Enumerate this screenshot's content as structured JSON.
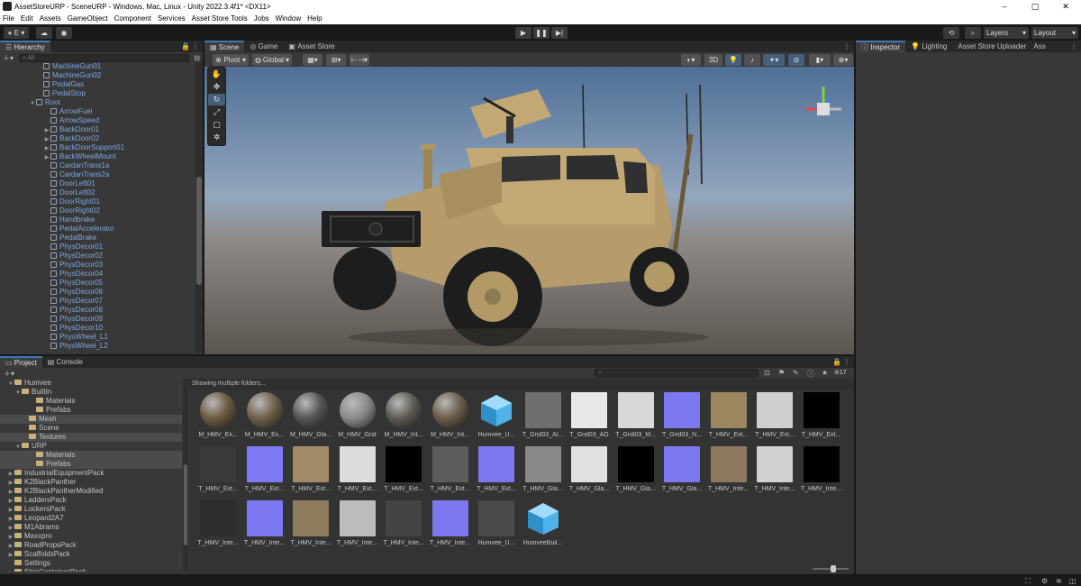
{
  "window": {
    "title": "AssetStoreURP - SceneURP - Windows, Mac, Linux - Unity 2022.3.4f1* <DX11>",
    "min": "–",
    "max": "▢",
    "close": "✕"
  },
  "menu": [
    "File",
    "Edit",
    "Assets",
    "GameObject",
    "Component",
    "Services",
    "Asset Store Tools",
    "Jobs",
    "Window",
    "Help"
  ],
  "toolbar": {
    "account": "E ▾",
    "layers": "Layers",
    "layout": "Layout"
  },
  "hierarchy": {
    "tab": "Hierarchy",
    "search_placeholder": "All",
    "items": [
      {
        "label": "MachineGun01",
        "indent": 5
      },
      {
        "label": "MachineGun02",
        "indent": 5
      },
      {
        "label": "PedalGas",
        "indent": 5
      },
      {
        "label": "PedalStop",
        "indent": 5
      },
      {
        "label": "Root",
        "indent": 4,
        "open": true
      },
      {
        "label": "ArrowFuel",
        "indent": 6
      },
      {
        "label": "ArrowSpeed",
        "indent": 6
      },
      {
        "label": "BackDoor01",
        "indent": 6,
        "closed": true
      },
      {
        "label": "BackDoor02",
        "indent": 6,
        "closed": true
      },
      {
        "label": "BackDoorSupport01",
        "indent": 6,
        "closed": true
      },
      {
        "label": "BackWheelMount",
        "indent": 6,
        "closed": true
      },
      {
        "label": "CardanTrans1a",
        "indent": 6
      },
      {
        "label": "CardanTrans2a",
        "indent": 6
      },
      {
        "label": "DoorLeft01",
        "indent": 6
      },
      {
        "label": "DoorLeft02",
        "indent": 6
      },
      {
        "label": "DoorRight01",
        "indent": 6
      },
      {
        "label": "DoorRight02",
        "indent": 6
      },
      {
        "label": "Handbrake",
        "indent": 6
      },
      {
        "label": "PedalAccelerator",
        "indent": 6
      },
      {
        "label": "PedalBrake",
        "indent": 6
      },
      {
        "label": "PhysDecor01",
        "indent": 6
      },
      {
        "label": "PhysDecor02",
        "indent": 6
      },
      {
        "label": "PhysDecor03",
        "indent": 6
      },
      {
        "label": "PhysDecor04",
        "indent": 6
      },
      {
        "label": "PhysDecor05",
        "indent": 6
      },
      {
        "label": "PhysDecor06",
        "indent": 6
      },
      {
        "label": "PhysDecor07",
        "indent": 6
      },
      {
        "label": "PhysDecor08",
        "indent": 6
      },
      {
        "label": "PhysDecor09",
        "indent": 6
      },
      {
        "label": "PhysDecor10",
        "indent": 6
      },
      {
        "label": "PhysWheel_L1",
        "indent": 6
      },
      {
        "label": "PhysWheel_L2",
        "indent": 6
      }
    ]
  },
  "scene": {
    "tabs": [
      "Scene",
      "Game",
      "Asset Store"
    ],
    "pivot": "Pivot",
    "global": "Global",
    "mode2d": "3D"
  },
  "inspector": {
    "tabs": [
      "Inspector",
      "Lighting",
      "Asset Store Uploader",
      "Ass"
    ]
  },
  "project": {
    "tabs": [
      "Project",
      "Console"
    ],
    "status": "Showing multiple folders...",
    "count": "17",
    "tree": [
      {
        "label": "Humvee",
        "indent": 1,
        "open": true
      },
      {
        "label": "BuiltIn",
        "indent": 2,
        "open": true
      },
      {
        "label": "Materials",
        "indent": 4
      },
      {
        "label": "Prefabs",
        "indent": 4
      },
      {
        "label": "Mesh",
        "indent": 3,
        "sel": true
      },
      {
        "label": "Scene",
        "indent": 3
      },
      {
        "label": "Textures",
        "indent": 3,
        "sel": true
      },
      {
        "label": "URP",
        "indent": 2,
        "open": true
      },
      {
        "label": "Materials",
        "indent": 4,
        "sel": true
      },
      {
        "label": "Prefabs",
        "indent": 4,
        "sel": true
      },
      {
        "label": "IndustrialEquipmentPack",
        "indent": 1,
        "closed": true
      },
      {
        "label": "K2BlackPanther",
        "indent": 1,
        "closed": true
      },
      {
        "label": "K2BlackPantherModified",
        "indent": 1,
        "closed": true
      },
      {
        "label": "LaddersPack",
        "indent": 1,
        "closed": true
      },
      {
        "label": "LockersPack",
        "indent": 1,
        "closed": true
      },
      {
        "label": "Leopard2A7",
        "indent": 1,
        "closed": true
      },
      {
        "label": "M1Abrams",
        "indent": 1,
        "closed": true
      },
      {
        "label": "Maxxpro",
        "indent": 1,
        "closed": true
      },
      {
        "label": "RoadPropsPack",
        "indent": 1,
        "closed": true
      },
      {
        "label": "ScaffoldsPack",
        "indent": 1,
        "closed": true
      },
      {
        "label": "Settings",
        "indent": 1
      },
      {
        "label": "ShipContainerPack",
        "indent": 1,
        "closed": true
      }
    ],
    "assets": [
      {
        "label": "M_HMV_Ex...",
        "kind": "sphere",
        "color": "#6b5a40"
      },
      {
        "label": "M_HMV_Ex...",
        "kind": "sphere",
        "color": "#6f6048"
      },
      {
        "label": "M_HMV_Gla...",
        "kind": "sphere",
        "color": "#555"
      },
      {
        "label": "M_HMV_Grid",
        "kind": "sphere",
        "color": "#8a8a8a"
      },
      {
        "label": "M_HMV_Int...",
        "kind": "sphere",
        "color": "#5d5a52"
      },
      {
        "label": "M_HMV_Int...",
        "kind": "sphere",
        "color": "#6a5c47"
      },
      {
        "label": "Humvee_U...",
        "kind": "cube",
        "color": "#4fb3ea"
      },
      {
        "label": "T_Grid03_Al...",
        "kind": "tex",
        "color": "#6f6f6f"
      },
      {
        "label": "T_Grid03_AO",
        "kind": "tex",
        "color": "#e8e8e8"
      },
      {
        "label": "T_Grid03_M...",
        "kind": "tex",
        "color": "#d8d8d8"
      },
      {
        "label": "T_Grid03_N...",
        "kind": "tex",
        "color": "#7b78f0"
      },
      {
        "label": "T_HMV_Ext...",
        "kind": "tex",
        "color": "#9c8660"
      },
      {
        "label": "T_HMV_Ext...",
        "kind": "tex",
        "color": "#cfcfcf"
      },
      {
        "label": "T_HMV_Ext...",
        "kind": "tex",
        "color": "#000"
      },
      {
        "label": "T_HMV_Ext...",
        "kind": "tex",
        "color": "#3a3a3a"
      },
      {
        "label": "T_HMV_Ext...",
        "kind": "tex",
        "color": "#7d7af2"
      },
      {
        "label": "T_HMV_Ext...",
        "kind": "tex",
        "color": "#a08a68"
      },
      {
        "label": "T_HMV_Ext...",
        "kind": "tex",
        "color": "#dcdcdc"
      },
      {
        "label": "T_HMV_Ext...",
        "kind": "tex",
        "color": "#000"
      },
      {
        "label": "T_HMV_Ext...",
        "kind": "tex",
        "color": "#5c5c5c"
      },
      {
        "label": "T_HMV_Ext...",
        "kind": "tex",
        "color": "#7b78f0"
      },
      {
        "label": "T_HMV_Gla...",
        "kind": "tex",
        "color": "#8a8a8a"
      },
      {
        "label": "T_HMV_Gla...",
        "kind": "tex",
        "color": "#e0e0e0"
      },
      {
        "label": "T_HMV_Gla...",
        "kind": "tex",
        "color": "#000"
      },
      {
        "label": "T_HMV_Gla...",
        "kind": "tex",
        "color": "#7b78f0"
      },
      {
        "label": "T_HMV_Inte...",
        "kind": "tex",
        "color": "#8d7a5e"
      },
      {
        "label": "T_HMV_Inte...",
        "kind": "tex",
        "color": "#d0d0d0"
      },
      {
        "label": "T_HMV_Inte...",
        "kind": "tex",
        "color": "#000"
      },
      {
        "label": "T_HMV_Inte...",
        "kind": "tex",
        "color": "#2d2d2d"
      },
      {
        "label": "T_HMV_Inte...",
        "kind": "tex",
        "color": "#7b78f0"
      },
      {
        "label": "T_HMV_Inte...",
        "kind": "tex",
        "color": "#8e7c5c"
      },
      {
        "label": "T_HMV_Inte...",
        "kind": "tex",
        "color": "#bdbdbd"
      },
      {
        "label": "T_HMV_Inte...",
        "kind": "tex",
        "color": "#444"
      },
      {
        "label": "T_HMV_Inte...",
        "kind": "tex",
        "color": "#7b78f0"
      },
      {
        "label": "Humvee_U...",
        "kind": "model",
        "color": "#555"
      },
      {
        "label": "HumveeBuil...",
        "kind": "prefab",
        "color": "#4fb3ea"
      }
    ]
  }
}
